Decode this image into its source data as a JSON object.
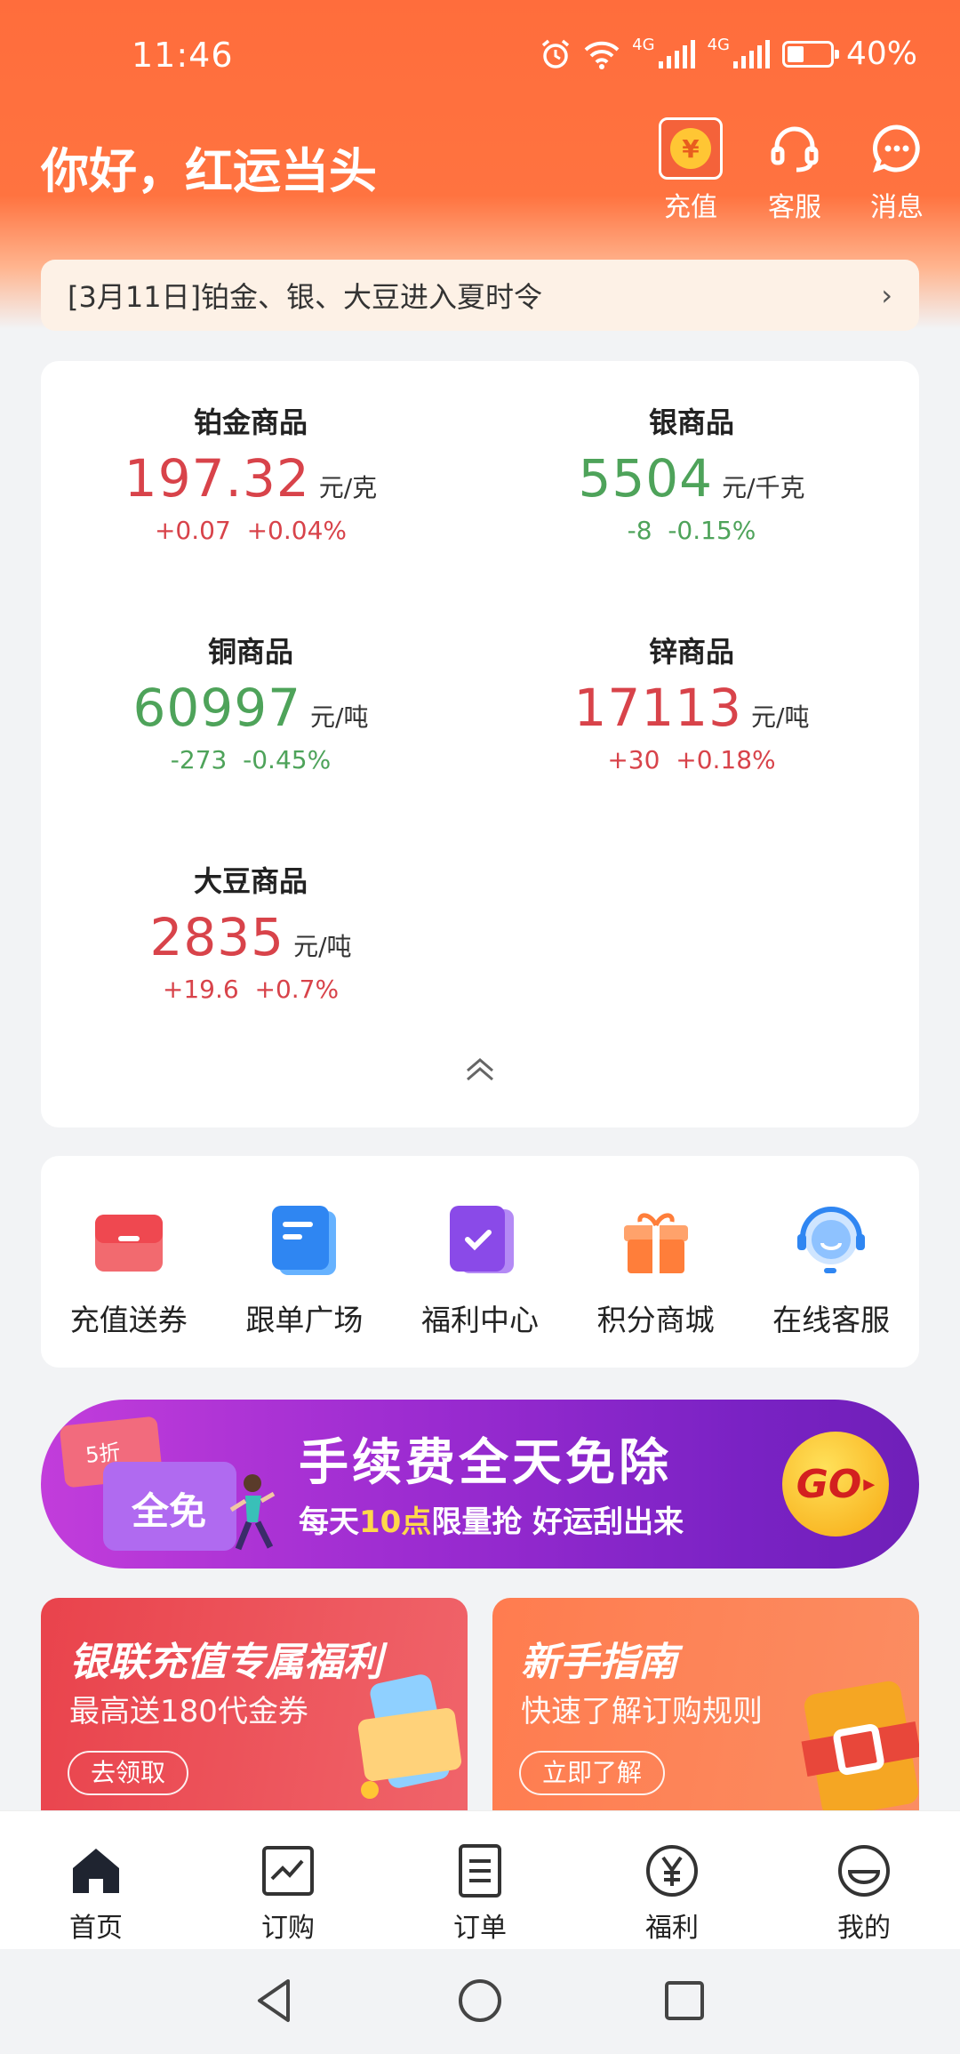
{
  "status_bar": {
    "time": "11:46",
    "network1": "4G",
    "network2": "4G",
    "battery": "40%"
  },
  "header": {
    "greeting": "你好，红运当头",
    "actions": [
      {
        "label": "充值",
        "icon": "yuan-coin-icon"
      },
      {
        "label": "客服",
        "icon": "headset-icon"
      },
      {
        "label": "消息",
        "icon": "chat-bubble-icon"
      }
    ],
    "recharge_symbol": "¥"
  },
  "notice": {
    "text": "[3月11日]铂金、银、大豆进入夏时令",
    "chevron": "›"
  },
  "prices": [
    {
      "name": "铂金商品",
      "value": "197.32",
      "unit": "元/克",
      "change": "+0.07",
      "percent": "+0.04%",
      "direction": "up"
    },
    {
      "name": "银商品",
      "value": "5504",
      "unit": "元/千克",
      "change": "-8",
      "percent": "-0.15%",
      "direction": "down"
    },
    {
      "name": "铜商品",
      "value": "60997",
      "unit": "元/吨",
      "change": "-273",
      "percent": "-0.45%",
      "direction": "down"
    },
    {
      "name": "锌商品",
      "value": "17113",
      "unit": "元/吨",
      "change": "+30",
      "percent": "+0.18%",
      "direction": "up"
    },
    {
      "name": "大豆商品",
      "value": "2835",
      "unit": "元/吨",
      "change": "+19.6",
      "percent": "+0.7%",
      "direction": "up"
    }
  ],
  "quick_actions": [
    {
      "label": "充值送券",
      "icon": "coupon-icon"
    },
    {
      "label": "跟单广场",
      "icon": "document-icon"
    },
    {
      "label": "福利中心",
      "icon": "checklist-icon"
    },
    {
      "label": "积分商城",
      "icon": "gift-icon"
    },
    {
      "label": "在线客服",
      "icon": "support-agent-icon"
    }
  ],
  "banner": {
    "tag1": "5折",
    "tag2": "全免",
    "title": "手续费全天免除",
    "sub_prefix": "每天",
    "sub_highlight": "10点",
    "sub_suffix": "限量抢 好运刮出来",
    "go": "GO"
  },
  "promos": [
    {
      "title": "银联充值专属福利",
      "subtitle": "最高送180代金券",
      "button": "去领取"
    },
    {
      "title": "新手指南",
      "subtitle": "快速了解订购规则",
      "button": "立即了解"
    }
  ],
  "tabbar": [
    {
      "label": "首页",
      "icon": "home-icon"
    },
    {
      "label": "订购",
      "icon": "trend-chart-icon"
    },
    {
      "label": "订单",
      "icon": "order-list-icon"
    },
    {
      "label": "福利",
      "icon": "yuan-circle-icon"
    },
    {
      "label": "我的",
      "icon": "smile-face-icon"
    }
  ],
  "colors": {
    "brand": "#ff6d3c",
    "up": "#d8434a",
    "down": "#4ea35a"
  }
}
